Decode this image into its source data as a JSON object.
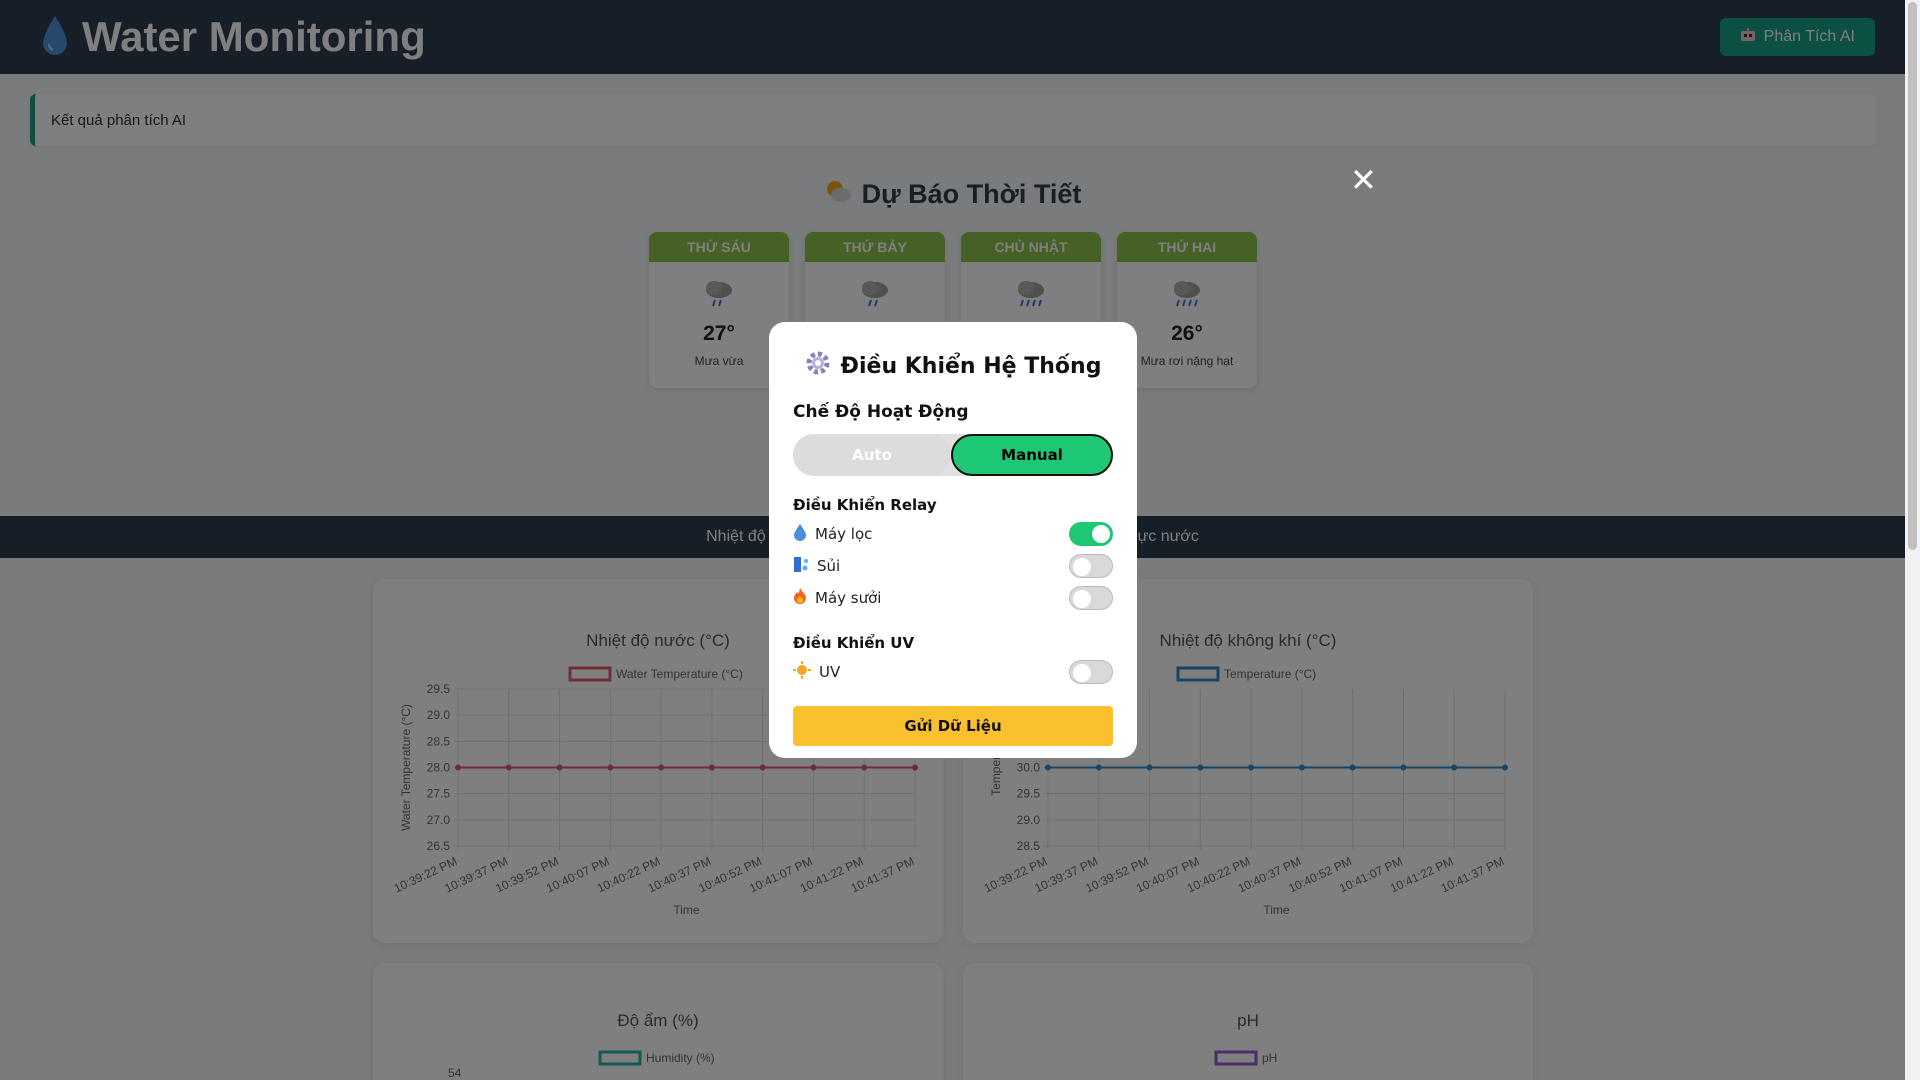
{
  "header": {
    "title": "Water Monitoring",
    "ai_button": "Phân Tích AI"
  },
  "ai_result": {
    "text": "Kết quả phân tích AI"
  },
  "weather": {
    "title": "Dự Báo Thời Tiết",
    "days": [
      {
        "day": "THỨ SÁU",
        "temp": "27°",
        "desc": "Mưa vừa"
      },
      {
        "day": "THỨ BẢY",
        "temp": "",
        "desc": ""
      },
      {
        "day": "CHỦ NHẬT",
        "temp": "",
        "desc": ""
      },
      {
        "day": "THỨ HAI",
        "temp": "26°",
        "desc": "Mưa rơi nặng hạt"
      }
    ]
  },
  "nav": {
    "items": [
      "Nhiệt độ nước",
      "Mực nước"
    ]
  },
  "charts": [
    {
      "title": "Nhiệt độ nước (°C)",
      "legend": "Water Temperature (°C)",
      "ylabel": "Water Temperature (°C)",
      "xlabel": "Time",
      "color": "#e05a6f"
    },
    {
      "title": "Nhiệt độ không khí (°C)",
      "legend": "Temperature (°C)",
      "ylabel": "Temperatu",
      "xlabel": "Time",
      "color": "#2f8ad0"
    },
    {
      "title": "Độ ẩm (%)",
      "legend": "Humidity (%)",
      "color": "#2cb5a8",
      "first_tick": "54"
    },
    {
      "title": "pH",
      "legend": "pH",
      "color": "#8e5cd6"
    }
  ],
  "chart_data": [
    {
      "type": "line",
      "title": "Nhiệt độ nước (°C)",
      "xlabel": "Time",
      "ylabel": "Water Temperature (°C)",
      "x": [
        "10:39:22 PM",
        "10:39:37 PM",
        "10:39:52 PM",
        "10:40:07 PM",
        "10:40:22 PM",
        "10:40:37 PM",
        "10:40:52 PM",
        "10:41:07 PM",
        "10:41:22 PM",
        "10:41:37 PM"
      ],
      "yticks": [
        "29.5",
        "29.0",
        "28.5",
        "28.0",
        "27.5",
        "27.0",
        "26.5"
      ],
      "ylim": [
        26.5,
        29.5
      ],
      "series": [
        {
          "name": "Water Temperature (°C)",
          "values": [
            28,
            28,
            28,
            28,
            28,
            28,
            28,
            28,
            28,
            28
          ]
        }
      ]
    },
    {
      "type": "line",
      "title": "Nhiệt độ không khí (°C)",
      "xlabel": "Time",
      "ylabel": "Temperatu",
      "x": [
        "10:39:22 PM",
        "10:39:37 PM",
        "10:39:52 PM",
        "10:40:07 PM",
        "10:40:22 PM",
        "10:40:37 PM",
        "10:40:52 PM",
        "10:41:07 PM",
        "10:41:22 PM",
        "10:41:37 PM"
      ],
      "yticks": [
        "30.0",
        "29.5",
        "29.0",
        "28.5"
      ],
      "ylim": [
        28.5,
        31.5
      ],
      "series": [
        {
          "name": "Temperature (°C)",
          "values": [
            30,
            30,
            30,
            30,
            30,
            30,
            30,
            30,
            30,
            30
          ]
        }
      ]
    }
  ],
  "modal": {
    "title": "Điều Khiển Hệ Thống",
    "mode_label": "Chế Độ Hoạt Động",
    "auto_label": "Auto",
    "manual_label": "Manual",
    "relay_label": "Điều Khiển Relay",
    "relays": [
      {
        "label": "Máy lọc",
        "on": true
      },
      {
        "label": "Sủi",
        "on": false
      },
      {
        "label": "Máy sưởi",
        "on": false
      }
    ],
    "uv_label": "Điều Khiển UV",
    "uv": {
      "label": "UV",
      "on": false
    },
    "send_label": "Gửi Dữ Liệu"
  }
}
